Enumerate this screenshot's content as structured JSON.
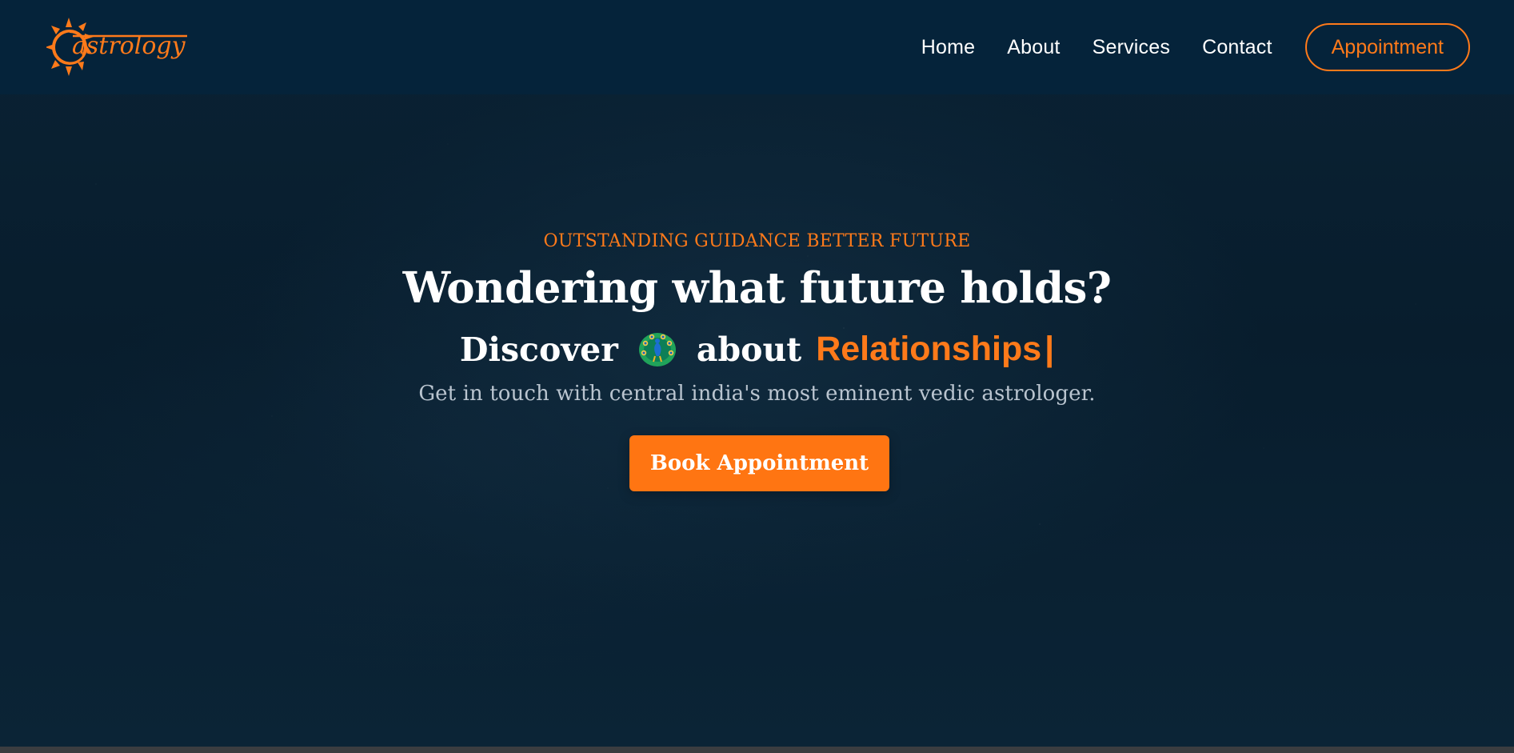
{
  "brand": {
    "logo_text": "astrology",
    "logo_icon": "sun-icon",
    "accent_color": "#ff7a1a"
  },
  "nav": {
    "items": [
      {
        "label": "Home"
      },
      {
        "label": "About"
      },
      {
        "label": "Services"
      },
      {
        "label": "Contact"
      }
    ],
    "cta_label": "Appointment"
  },
  "hero": {
    "eyebrow": "OUTSTANDING GUIDANCE BETTER FUTURE",
    "headline": "Wondering what future holds?",
    "subline_prefix": "Discover",
    "subline_icon": "peacock-icon",
    "subline_middle": "about",
    "subline_highlight": "Relationships",
    "subline_cursor": "|",
    "description": "Get in touch with central india's most eminent vedic astrologer.",
    "button_label": "Book Appointment"
  },
  "colors": {
    "header_background": "#05233a",
    "page_background": "#071a2a",
    "accent": "#ff7a1a",
    "button": "#ff7512",
    "text": "#ffffff",
    "muted_text": "#b9c4cf"
  }
}
